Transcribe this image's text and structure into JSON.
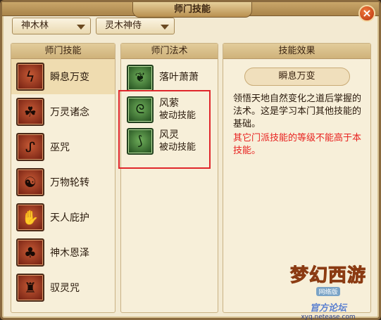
{
  "window": {
    "title": "师门技能",
    "close_label": "×"
  },
  "filters": {
    "sect": "神木林",
    "role": "灵木神侍"
  },
  "skills_panel": {
    "header": "师门技能",
    "items": [
      {
        "label": "瞬息万变",
        "icon": "lightning-icon",
        "glyph": "ϟ"
      },
      {
        "label": "万灵诸念",
        "icon": "beast-icon",
        "glyph": "☘"
      },
      {
        "label": "巫咒",
        "icon": "curse-icon",
        "glyph": "ᔑ"
      },
      {
        "label": "万物轮转",
        "icon": "yin-yang-icon",
        "glyph": "☯"
      },
      {
        "label": "天人庇护",
        "icon": "hands-icon",
        "glyph": "✋"
      },
      {
        "label": "神木恩泽",
        "icon": "tree-icon",
        "glyph": "♣"
      },
      {
        "label": "驭灵咒",
        "icon": "spirit-icon",
        "glyph": "♜"
      }
    ]
  },
  "spells_panel": {
    "header": "师门法术",
    "items": [
      {
        "name": "落叶萧萧",
        "sub": "",
        "icon": "leaves-icon",
        "glyph": "❦"
      },
      {
        "name": "风萦",
        "sub": "被动技能",
        "icon": "wind-icon",
        "glyph": "ᘓ"
      },
      {
        "name": "风灵",
        "sub": "被动技能",
        "icon": "whirlwind-icon",
        "glyph": "⟆"
      }
    ]
  },
  "effect_panel": {
    "header": "技能效果",
    "skill_name": "瞬息万变",
    "description": "领悟天地自然变化之道后掌握的法术。这是学习本门其他技能的基础。",
    "warning": "其它门派技能的等级不能高于本技能。"
  },
  "watermark": {
    "logo": "梦幻西游",
    "badge": "网络版",
    "subtitle": "官方论坛",
    "url": "xyq.netease.com"
  },
  "colors": {
    "highlight": "#e0262b",
    "warning": "#e8211f"
  }
}
